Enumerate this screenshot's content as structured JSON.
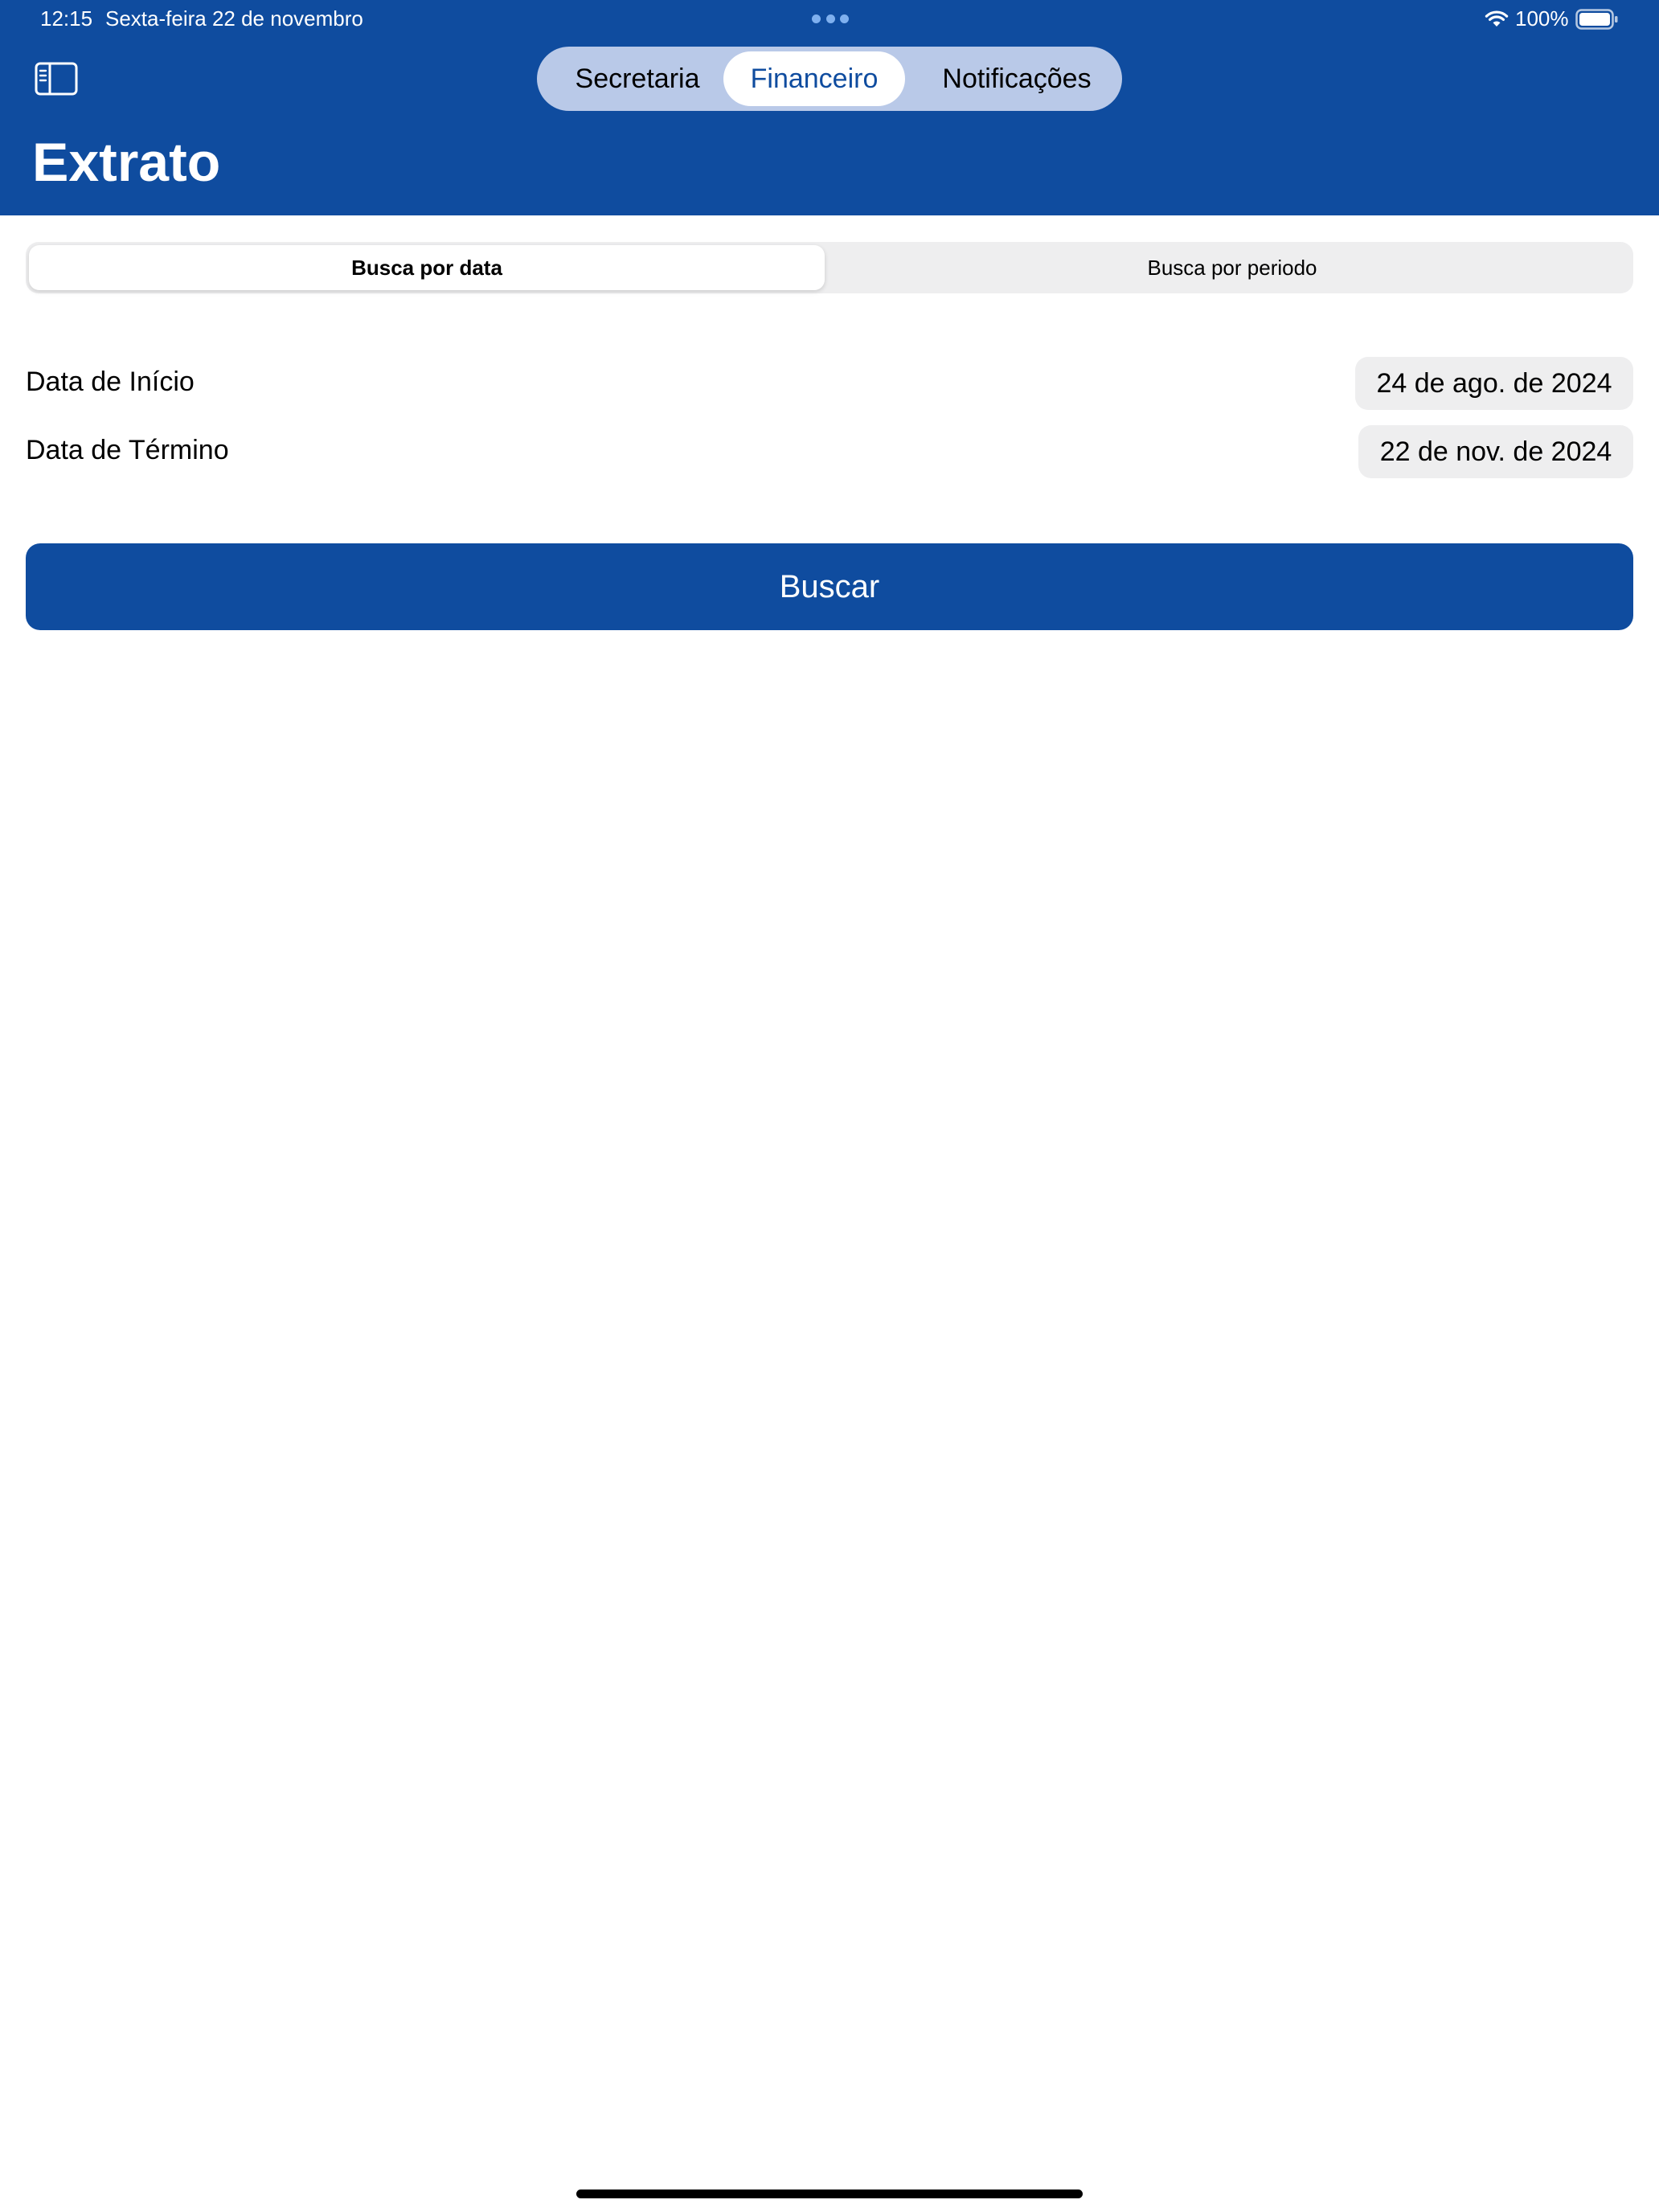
{
  "status_bar": {
    "time": "12:15",
    "date": "Sexta-feira 22 de novembro",
    "battery": "100%"
  },
  "nav": {
    "tabs": [
      {
        "label": "Secretaria"
      },
      {
        "label": "Financeiro"
      },
      {
        "label": "Notificações"
      }
    ],
    "selected": "Financeiro"
  },
  "page": {
    "title": "Extrato"
  },
  "segments": [
    {
      "label": "Busca por data"
    },
    {
      "label": "Busca por periodo"
    }
  ],
  "form": {
    "start_label": "Data de Início",
    "start_value": "24 de ago. de 2024",
    "end_label": "Data de Término",
    "end_value": "22 de nov. de 2024",
    "search_label": "Buscar"
  },
  "colors": {
    "brand": "#0f4c9f",
    "tab_track": "#b9c9e8",
    "control_bg": "#eeeeef"
  },
  "icons": {
    "sidebar": "sidebar-toggle-icon",
    "wifi": "wifi-icon",
    "battery": "battery-icon"
  }
}
